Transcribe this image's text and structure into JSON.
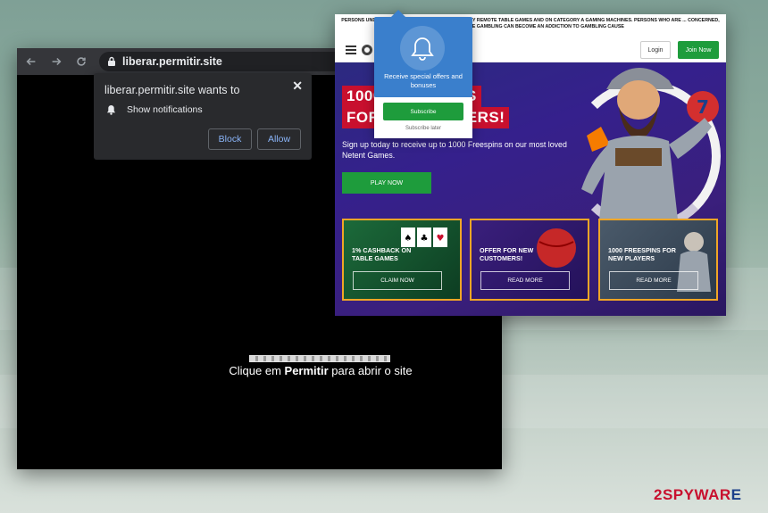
{
  "browser": {
    "url": "liberar.permitir.site",
    "notification_prompt": {
      "title": "liberar.permitir.site wants to",
      "permission": "Show notifications",
      "block_label": "Block",
      "allow_label": "Allow",
      "close_label": "✕"
    },
    "page": {
      "instruction_prefix": "Clique em ",
      "instruction_bold": "Permitir",
      "instruction_suffix": " para abrir o site"
    }
  },
  "casino": {
    "disclaimer": "PERSONS UNDER 18 YEARS ARE NOT ALLOWED TO PLAY REMOTE TABLE GAMES AND ON CATEGORY A GAMING MACHINES. PERSONS WHO ARE ... CONCERNED, IRRESPONSIBLE GAMBLING CAN BECOME AN ADDICTION TO GAMBLING CAUSE",
    "login_label": "Login",
    "join_label": "Join Now",
    "headline_line1": "1000 FREESPINS",
    "headline_line2": "FOR NEW PLAYERS!",
    "subtext": "Sign up today to receive up to 1000 Freespins on our most loved Netent Games.",
    "play_label": "PLAY NOW",
    "cards": [
      {
        "title": "1% CASHBACK ON TABLE GAMES",
        "button": "CLAIM NOW"
      },
      {
        "title": "OFFER FOR NEW CUSTOMERS!",
        "button": "READ MORE"
      },
      {
        "title": "1000 FREESPINS FOR NEW PLAYERS",
        "button": "READ MORE"
      }
    ]
  },
  "push_prompt": {
    "text": "Receive special offers and bonuses",
    "subscribe_label": "Subscribe",
    "later_label": "Subscribe later"
  },
  "watermark": {
    "part1": "2SPYWAR",
    "part2": "E"
  },
  "colors": {
    "chrome_toolbar": "#35363a",
    "link_blue": "#8ab4f8",
    "casino_green": "#1e9c3c",
    "casino_red": "#c8102e",
    "card_border": "#f0a626",
    "push_blue": "#3a7fcc"
  }
}
